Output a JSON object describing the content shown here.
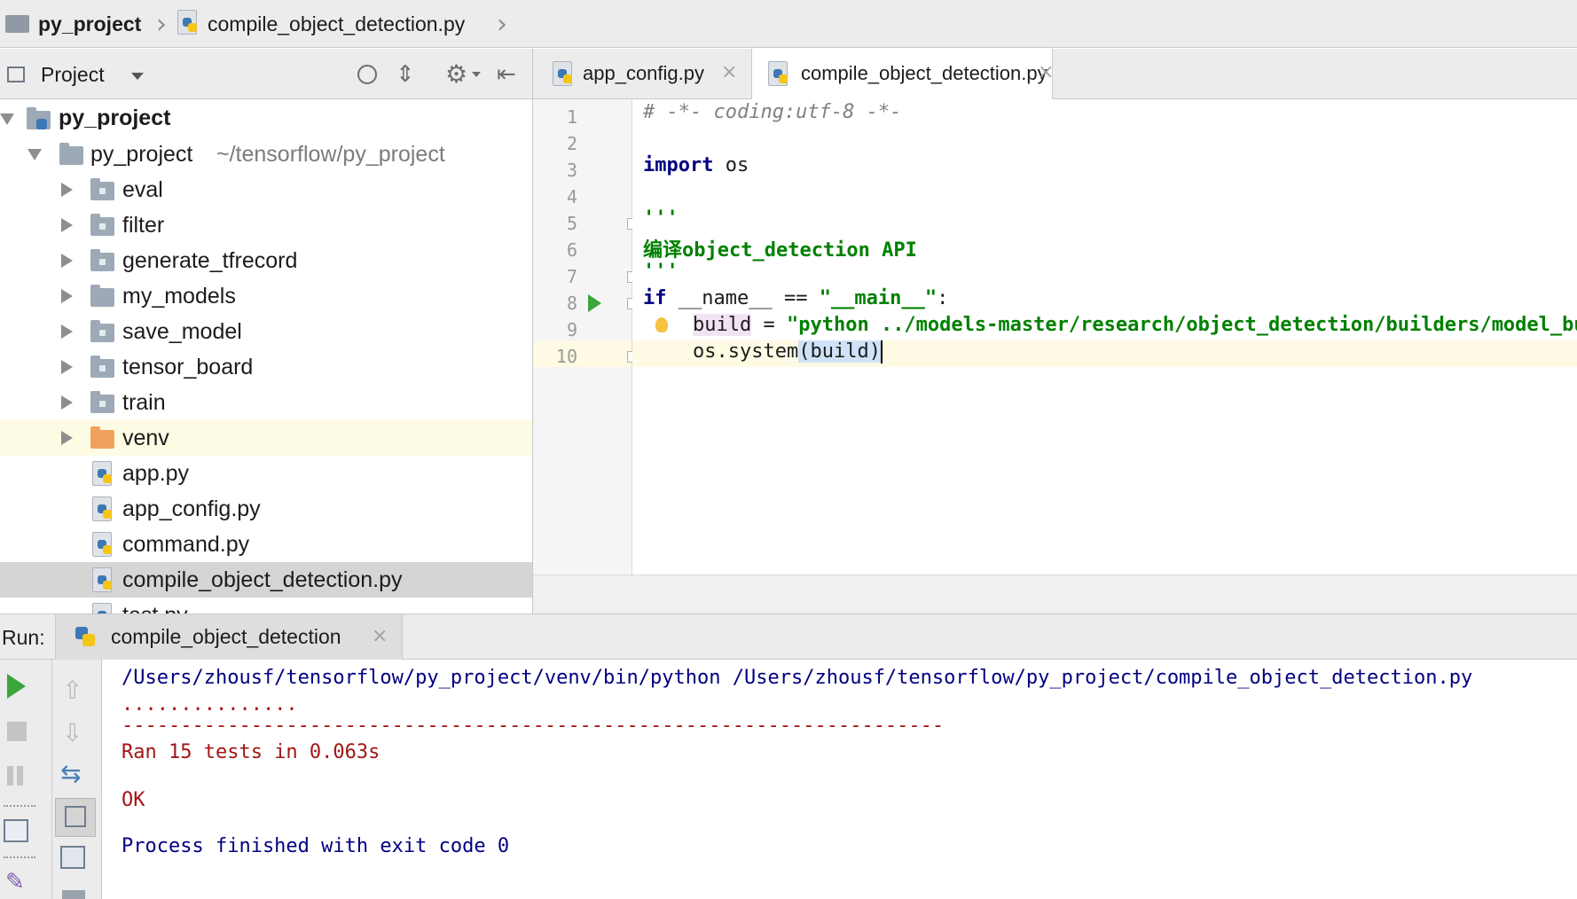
{
  "breadcrumb": {
    "project": "py_project",
    "file": "compile_object_detection.py"
  },
  "project_panel": {
    "title": "Project",
    "tree": [
      {
        "label": "py_project",
        "kind": "project-root",
        "expanded": true
      },
      {
        "label": "py_project",
        "path": "~/tensorflow/py_project",
        "kind": "folder",
        "expanded": true
      },
      {
        "label": "eval",
        "kind": "package"
      },
      {
        "label": "filter",
        "kind": "package"
      },
      {
        "label": "generate_tfrecord",
        "kind": "package"
      },
      {
        "label": "my_models",
        "kind": "folder"
      },
      {
        "label": "save_model",
        "kind": "package"
      },
      {
        "label": "tensor_board",
        "kind": "package"
      },
      {
        "label": "train",
        "kind": "package"
      },
      {
        "label": "venv",
        "kind": "venv"
      },
      {
        "label": "app.py",
        "kind": "python-file"
      },
      {
        "label": "app_config.py",
        "kind": "python-file"
      },
      {
        "label": "command.py",
        "kind": "python-file"
      },
      {
        "label": "compile_object_detection.py",
        "kind": "python-file",
        "selected": true
      },
      {
        "label": "test.py",
        "kind": "python-file"
      }
    ]
  },
  "editor": {
    "tabs": [
      {
        "label": "app_config.py",
        "active": false
      },
      {
        "label": "compile_object_detection.py",
        "active": true
      }
    ],
    "line_numbers": [
      "1",
      "2",
      "3",
      "4",
      "5",
      "6",
      "7",
      "8",
      "9",
      "10"
    ],
    "lines": {
      "l1": "# -*- coding:utf-8 -*-",
      "l3_kw": "import",
      "l3_rest": " os",
      "l5": "'''",
      "l6": "编译object_detection API",
      "l7": "'''",
      "l8_kw": "if",
      "l8_mid": " __name__ == ",
      "l8_str": "\"__main__\"",
      "l8_end": ":",
      "l9_var": "build",
      "l9_eq": " = ",
      "l9_str": "\"python ../models-master/research/object_detection/builders/model_builder_test.py\"",
      "l10_a": "os.system",
      "l10_b": "(build)"
    }
  },
  "run_panel": {
    "label": "Run:",
    "tab": "compile_object_detection",
    "console": {
      "command": "/Users/zhousf/tensorflow/py_project/venv/bin/python /Users/zhousf/tensorflow/py_project/compile_object_detection.py",
      "dots": "...............",
      "rule": "----------------------------------------------------------------------",
      "ran": "Ran 15 tests in 0.063s",
      "ok": "OK",
      "finished": "Process finished with exit code 0"
    }
  },
  "colors": {
    "keyword": "#000080",
    "string": "#008000",
    "comment": "#808080",
    "stderr": "#a31515",
    "stdout": "#000080",
    "run_green": "#3aa53a",
    "selected_row": "#d5d5d5",
    "venv_highlight": "#fdfbe3",
    "current_line": "#fffae3"
  }
}
